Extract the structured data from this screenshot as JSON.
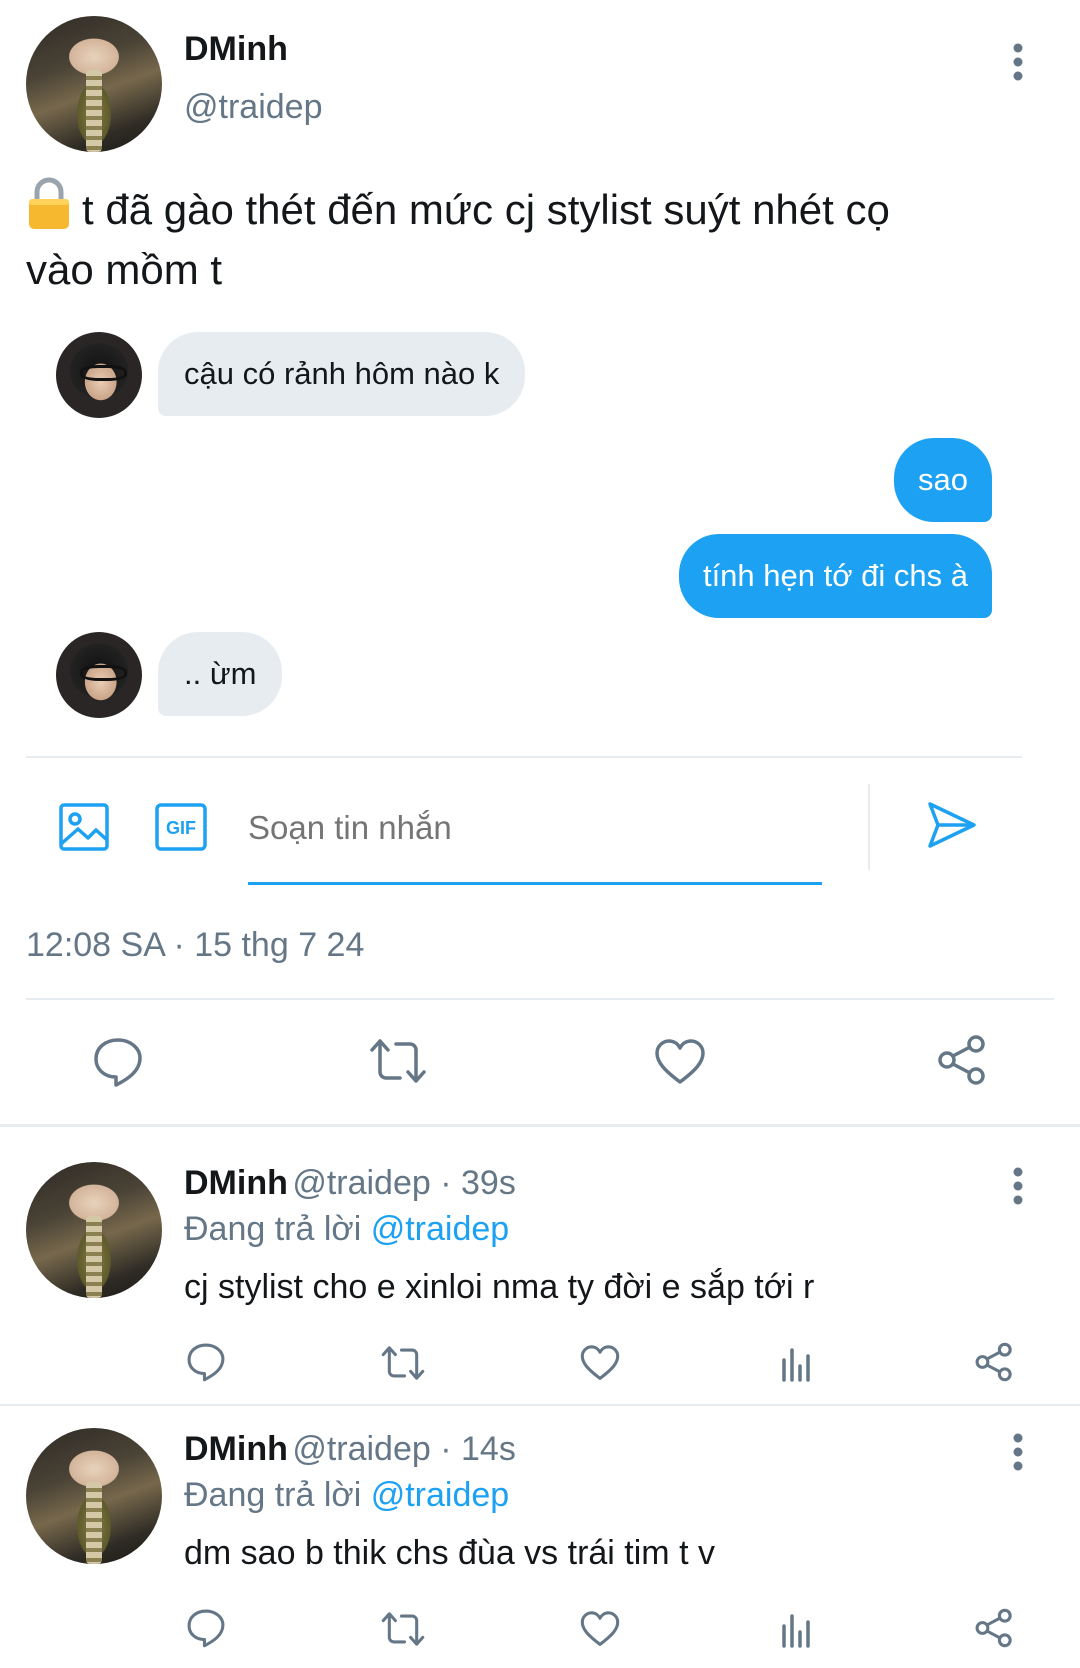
{
  "main_tweet": {
    "author_name": "DMinh",
    "author_handle": "@traidep",
    "text_line1": "t đã gào thét đến mức cj stylist suýt nhét cọ",
    "text_line2": "vào mồm t",
    "lock_emoji": "🔒",
    "timestamp": "12:08 SA · 15 thg 7 24"
  },
  "chat": {
    "messages": [
      {
        "side": "incoming",
        "text": "cậu có rảnh hôm nào k"
      },
      {
        "side": "outgoing",
        "text": "sao"
      },
      {
        "side": "outgoing",
        "text": "tính hẹn tớ đi chs à"
      },
      {
        "side": "incoming",
        "text": ".. ừm"
      }
    ],
    "compose_placeholder": "Soạn tin nhắn",
    "icons": [
      "image-icon",
      "gif-icon",
      "send-icon"
    ],
    "gif_label": "GIF"
  },
  "actions": [
    "reply-icon",
    "retweet-icon",
    "like-icon",
    "share-icon"
  ],
  "replies": [
    {
      "author_name": "DMinh",
      "meta": "@traidep · 39s",
      "replying_prefix": "Đang trả lời",
      "replying_to": "@traidep",
      "text": "cj stylist cho e xinloi nma ty đời e sắp tới r"
    },
    {
      "author_name": "DMinh",
      "meta": "@traidep · 14s",
      "replying_prefix": "Đang trả lời",
      "replying_to": "@traidep",
      "text": "dm sao b thik chs đùa vs trái tim t v"
    }
  ],
  "colors": {
    "accent": "#1da1f2",
    "secondary_text": "#657786",
    "bubble_incoming": "#e6ecf0"
  }
}
